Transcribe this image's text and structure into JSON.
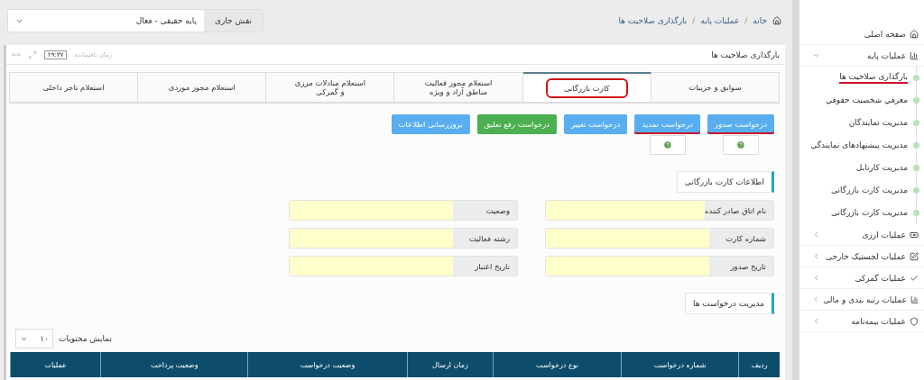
{
  "header": {
    "role_label": "نقش جاری",
    "role_value": "پایه حقیقی - فعال",
    "breadcrumb": [
      "خانه",
      "عملیات پایه",
      "بارگذاری صلاحیت ها"
    ],
    "breadcrumb_separator": "/"
  },
  "panel": {
    "title": "بارگذاری صلاحیت ها",
    "timer_label": "زمان باقیمانده",
    "timer_value": "۲۹:۳۷"
  },
  "tabs": [
    {
      "label": "سوابق و جزییات",
      "selected": false,
      "annotated": false
    },
    {
      "label": "کارت بازرگانی",
      "selected": true,
      "annotated": true
    },
    {
      "label": "استعلام مجوز فعالیت مناطق آزاد و ویژه",
      "selected": false,
      "annotated": false
    },
    {
      "label": "استعلام مبادلات مرزی و گمرکی",
      "selected": false,
      "annotated": false
    },
    {
      "label": "استعلام مجوز موردی",
      "selected": false,
      "annotated": false
    },
    {
      "label": "استعلام تاجر داخلی",
      "selected": false,
      "annotated": false
    }
  ],
  "actions": [
    {
      "label": "درخواست صدور",
      "kind": "primary",
      "help": true,
      "annotated": true
    },
    {
      "label": "درخواست تمدید",
      "kind": "primary",
      "help": true,
      "annotated": true
    },
    {
      "label": "درخواست تغییر",
      "kind": "primary",
      "help": false,
      "annotated": false
    },
    {
      "label": "درخواست رفع تعلیق",
      "kind": "success",
      "help": false,
      "annotated": false
    },
    {
      "label": "بروزرسانی اطلاعات",
      "kind": "primary",
      "help": false,
      "annotated": false
    }
  ],
  "card_section": {
    "title": "اطلاعات کارت بازرگانی",
    "fields": [
      {
        "label": "نام اتاق صادر کننده"
      },
      {
        "label": "وضعیت"
      },
      {
        "label": "شماره کارت"
      },
      {
        "label": "رشته فعالیت"
      },
      {
        "label": "تاریخ صدور"
      },
      {
        "label": "تاریخ اعتبار"
      }
    ]
  },
  "requests_section": {
    "title": "مدیریت درخواست ها",
    "page_size_label": "نمایش محتویات",
    "page_size": "۱۰",
    "columns": [
      "ردیف",
      "شماره درخواست",
      "نوع درخواست",
      "زمان ارسال",
      "وضعیت درخواست",
      "وضعیت پرداخت",
      "عملیات"
    ]
  },
  "sidebar": {
    "items": [
      {
        "label": "صفحه اصلی"
      },
      {
        "label": "عملیات پایه",
        "expanded": true,
        "children": [
          {
            "label": "بارگذاری صلاحیت ها",
            "annotated": true
          },
          {
            "label": "معرفي شخصيت حقوقي",
            "annotated": false
          },
          {
            "label": "مدیریت نمایندگان",
            "annotated": false
          },
          {
            "label": "مدیریت پیشنهادهای نمایندگی",
            "annotated": false
          },
          {
            "label": "مدیریت کارتابل",
            "annotated": false
          },
          {
            "label": "مدیریت کارت بازرگانی",
            "annotated": false
          },
          {
            "label": "مدیریت کارت بازرگانی",
            "annotated": false
          }
        ]
      },
      {
        "label": "عملیات ارزی",
        "expanded": false
      },
      {
        "label": "عملیات لجستیک خارجی",
        "expanded": false
      },
      {
        "label": "عملیات گمرکی",
        "expanded": false
      },
      {
        "label": "عملیات رتبه بندی و مالی",
        "expanded": false
      },
      {
        "label": "عملیات بیمه‌نامه",
        "expanded": false
      }
    ]
  }
}
